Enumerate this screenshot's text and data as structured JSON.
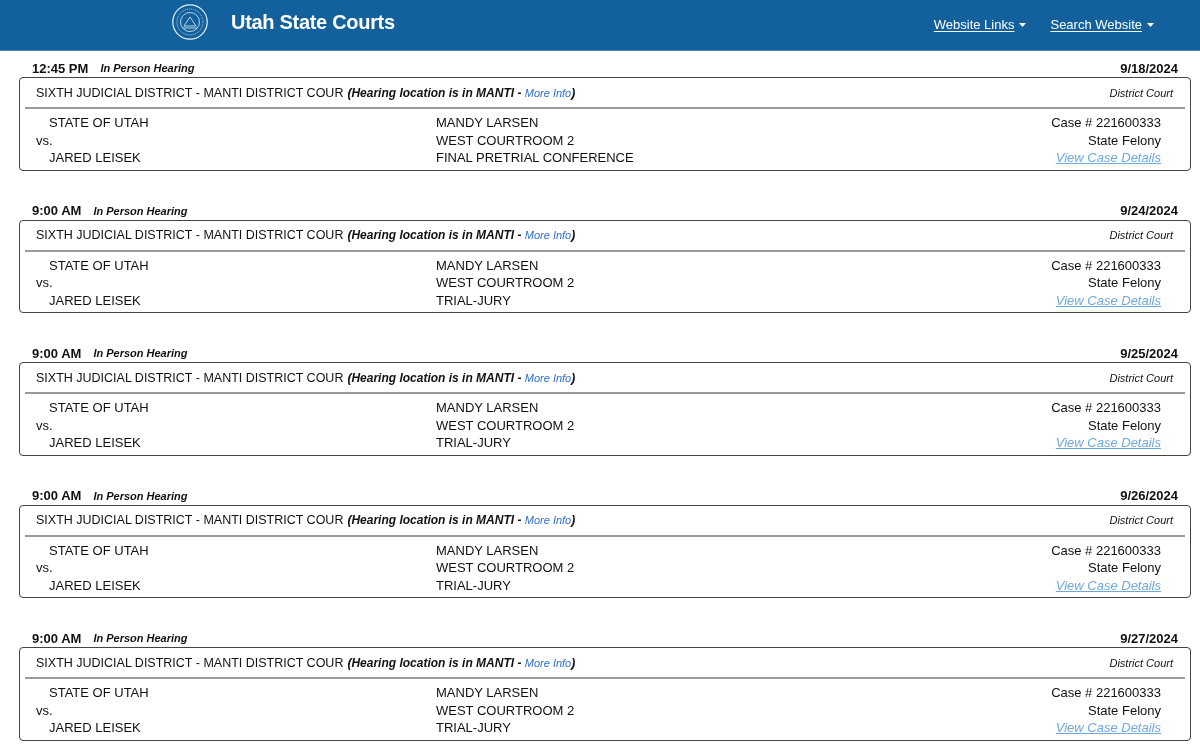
{
  "header": {
    "title": "Utah State Courts",
    "nav": [
      {
        "label": "Website Links"
      },
      {
        "label": "Search Website"
      }
    ]
  },
  "hearings": [
    {
      "time": "12:45 PM",
      "mode": "In Person Hearing",
      "date": "9/18/2024",
      "court": "SIXTH JUDICIAL DISTRICT - MANTI DISTRICT COUR",
      "location_note": "(Hearing location is in MANTI -",
      "location_link": "More Info",
      "location_note_end": ")",
      "court_type": "District Court",
      "plaintiff": "STATE OF UTAH",
      "versus": "vs.",
      "defendant": "JARED LEISEK",
      "judge": "MANDY LARSEN",
      "courtroom": "WEST COURTROOM 2",
      "hearing_type": "FINAL PRETRIAL CONFERENCE",
      "case_number": "Case # 221600333",
      "case_type": "State Felony",
      "details_link": "View Case Details"
    },
    {
      "time": "9:00 AM",
      "mode": "In Person Hearing",
      "date": "9/24/2024",
      "court": "SIXTH JUDICIAL DISTRICT - MANTI DISTRICT COUR",
      "location_note": "(Hearing location is in MANTI -",
      "location_link": "More Info",
      "location_note_end": ")",
      "court_type": "District Court",
      "plaintiff": "STATE OF UTAH",
      "versus": "vs.",
      "defendant": "JARED LEISEK",
      "judge": "MANDY LARSEN",
      "courtroom": "WEST COURTROOM 2",
      "hearing_type": "TRIAL-JURY",
      "case_number": "Case # 221600333",
      "case_type": "State Felony",
      "details_link": "View Case Details"
    },
    {
      "time": "9:00 AM",
      "mode": "In Person Hearing",
      "date": "9/25/2024",
      "court": "SIXTH JUDICIAL DISTRICT - MANTI DISTRICT COUR",
      "location_note": "(Hearing location is in MANTI -",
      "location_link": "More Info",
      "location_note_end": ")",
      "court_type": "District Court",
      "plaintiff": "STATE OF UTAH",
      "versus": "vs.",
      "defendant": "JARED LEISEK",
      "judge": "MANDY LARSEN",
      "courtroom": "WEST COURTROOM 2",
      "hearing_type": "TRIAL-JURY",
      "case_number": "Case # 221600333",
      "case_type": "State Felony",
      "details_link": "View Case Details"
    },
    {
      "time": "9:00 AM",
      "mode": "In Person Hearing",
      "date": "9/26/2024",
      "court": "SIXTH JUDICIAL DISTRICT - MANTI DISTRICT COUR",
      "location_note": "(Hearing location is in MANTI -",
      "location_link": "More Info",
      "location_note_end": ")",
      "court_type": "District Court",
      "plaintiff": "STATE OF UTAH",
      "versus": "vs.",
      "defendant": "JARED LEISEK",
      "judge": "MANDY LARSEN",
      "courtroom": "WEST COURTROOM 2",
      "hearing_type": "TRIAL-JURY",
      "case_number": "Case # 221600333",
      "case_type": "State Felony",
      "details_link": "View Case Details"
    },
    {
      "time": "9:00 AM",
      "mode": "In Person Hearing",
      "date": "9/27/2024",
      "court": "SIXTH JUDICIAL DISTRICT - MANTI DISTRICT COUR",
      "location_note": "(Hearing location is in MANTI -",
      "location_link": "More Info",
      "location_note_end": ")",
      "court_type": "District Court",
      "plaintiff": "STATE OF UTAH",
      "versus": "vs.",
      "defendant": "JARED LEISEK",
      "judge": "MANDY LARSEN",
      "courtroom": "WEST COURTROOM 2",
      "hearing_type": "TRIAL-JURY",
      "case_number": "Case # 221600333",
      "case_type": "State Felony",
      "details_link": "View Case Details"
    }
  ]
}
